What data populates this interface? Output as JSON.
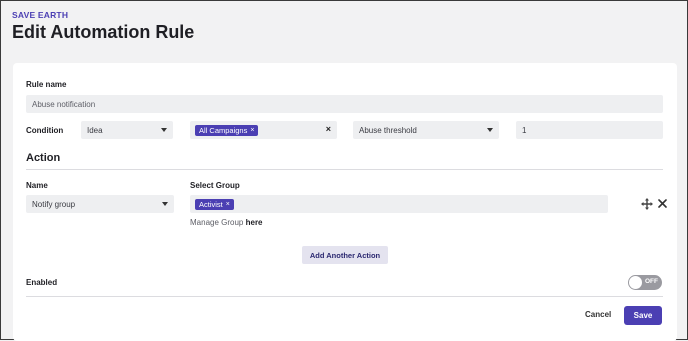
{
  "header": {
    "org_name": "SAVE EARTH",
    "page_title": "Edit Automation Rule"
  },
  "rule_name": {
    "label": "Rule name",
    "value": "Abuse notification"
  },
  "condition": {
    "label": "Condition",
    "type_value": "Idea",
    "campaign_tag": "All Campaigns",
    "metric_value": "Abuse threshold",
    "threshold_value": "1"
  },
  "action": {
    "section_title": "Action",
    "name_label": "Name",
    "name_value": "Notify group",
    "group_label": "Select Group",
    "group_tag": "Activist",
    "manage_prefix": "Manage Group",
    "manage_link": "here",
    "add_button": "Add Another Action"
  },
  "enabled": {
    "label": "Enabled",
    "toggle_state": "OFF"
  },
  "footer": {
    "cancel_label": "Cancel",
    "save_label": "Save"
  },
  "tag_remove_glyph": "×",
  "colors": {
    "accent": "#4b3fb3",
    "field_bg": "#eeeff1",
    "page_bg": "#f2f2f3"
  }
}
